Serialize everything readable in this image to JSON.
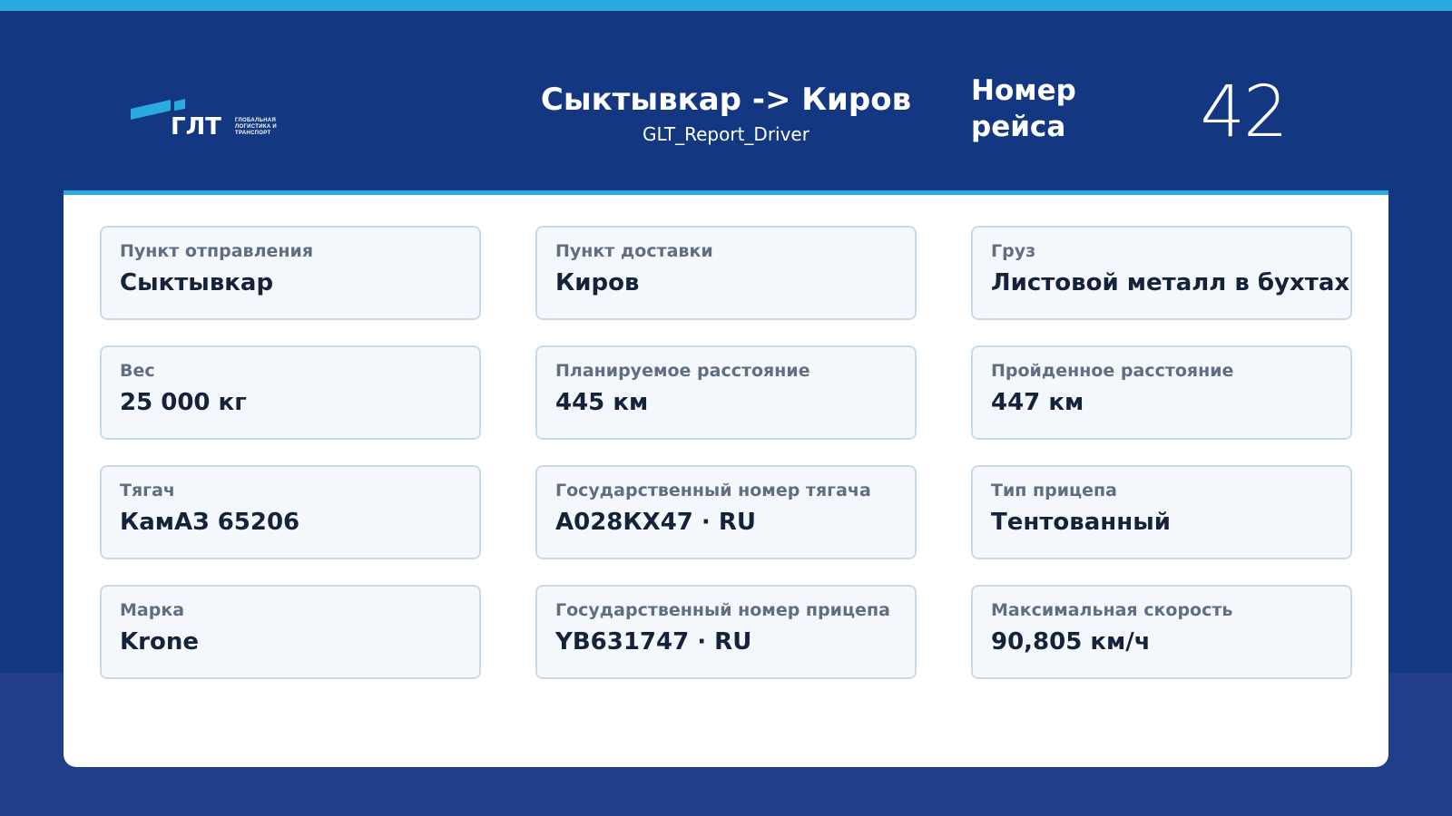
{
  "header": {
    "route_title": "Сыктывкар -> Киров",
    "report_name": "GLT_Report_Driver",
    "trip_label_line1": "Номер",
    "trip_label_line2": "рейса",
    "trip_number": "42",
    "logo": {
      "wordmark": "ГЛТ",
      "subtitle_line1": "ГЛОБАЛЬНАЯ",
      "subtitle_line2": "ЛОГИСТИКА И",
      "subtitle_line3": "ТРАНСПОРТ"
    }
  },
  "fields": [
    {
      "label": "Пункт отправления",
      "value": "Сыктывкар"
    },
    {
      "label": "Пункт доставки",
      "value": "Киров"
    },
    {
      "label": "Груз",
      "value": "Листовой металл в бухтах"
    },
    {
      "label": "Вес",
      "value": "25 000 кг"
    },
    {
      "label": "Планируемое расстояние",
      "value": "445 км"
    },
    {
      "label": "Пройденное расстояние",
      "value": "447 км"
    },
    {
      "label": "Тягач",
      "value": "КамАЗ 65206"
    },
    {
      "label": "Государственный номер тягача",
      "value": "А028КХ47 · RU"
    },
    {
      "label": "Тип прицепа",
      "value": "Тентованный"
    },
    {
      "label": "Марка",
      "value": "Krone"
    },
    {
      "label": "Государственный номер прицепа",
      "value": "YB631747 · RU"
    },
    {
      "label": "Максимальная скорость",
      "value": "90,805 км/ч"
    }
  ],
  "colors": {
    "header_bg": "#133781",
    "accent": "#29abe2",
    "card_bg": "#f4f8fd",
    "card_border": "#c8dbea"
  }
}
